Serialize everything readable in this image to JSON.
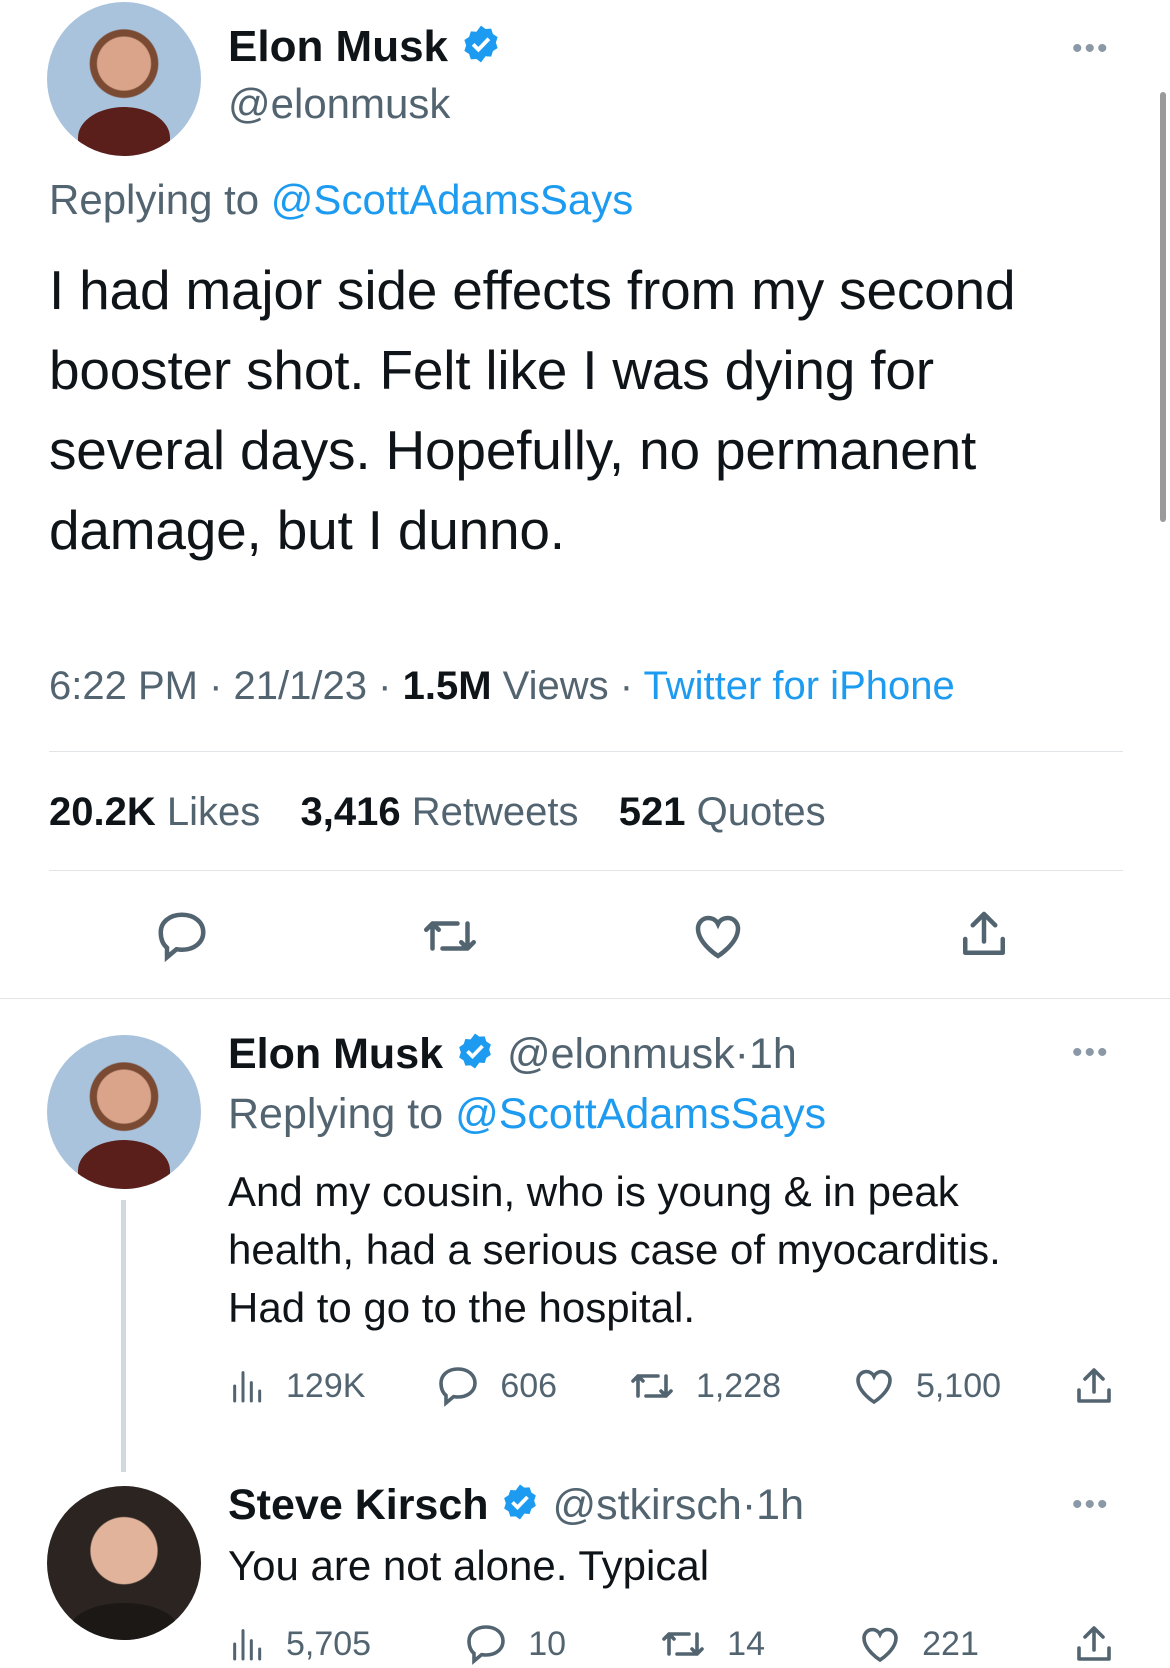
{
  "main_tweet": {
    "author_name": "Elon Musk",
    "handle": "@elonmusk",
    "replying_label": "Replying to",
    "replying_to": "@ScottAdamsSays",
    "text": "I had major side effects from my second booster shot. Felt like I was dying for several days. Hopefully, no permanent damage, but I dunno.",
    "time": "6:22 PM",
    "date": "21/1/23",
    "views_value": "1.5M",
    "views_label": "Views",
    "source": "Twitter for iPhone",
    "likes_value": "20.2K",
    "likes_label": "Likes",
    "retweets_value": "3,416",
    "retweets_label": "Retweets",
    "quotes_value": "521",
    "quotes_label": "Quotes"
  },
  "reply1": {
    "author_name": "Elon Musk",
    "handle": "@elonmusk",
    "time": "1h",
    "replying_label": "Replying to",
    "replying_to": "@ScottAdamsSays",
    "text_lines": [
      "And my cousin, who is young & in peak",
      "health, had a serious case of myocarditis.",
      "Had to go to the hospital."
    ],
    "views": "129K",
    "replies": "606",
    "retweets": "1,228",
    "likes": "5,100"
  },
  "reply2": {
    "author_name": "Steve Kirsch",
    "handle": "@stkirsch",
    "time": "1h",
    "text": "You are not alone. Typical",
    "views": "5,705",
    "replies": "10",
    "retweets": "14",
    "likes": "221"
  },
  "separator": "·",
  "colors": {
    "accent": "#1d9bf0",
    "text": "#0f1419",
    "secondary": "#536471"
  },
  "icons": [
    "verified-badge-icon",
    "more-icon",
    "reply-icon",
    "retweet-icon",
    "like-icon",
    "share-icon",
    "views-icon"
  ]
}
